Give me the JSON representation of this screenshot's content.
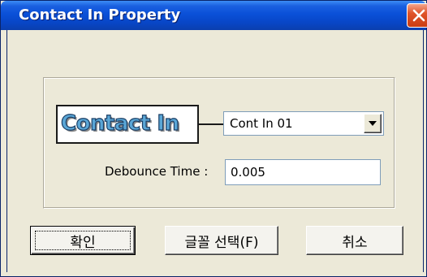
{
  "window": {
    "title": "Contact In Property"
  },
  "logo": {
    "text": "Contact In"
  },
  "contact_select": {
    "selected": "Cont In 01"
  },
  "debounce": {
    "label": "Debounce Time :",
    "value": "0.005"
  },
  "buttons": {
    "ok": "확인",
    "font_select": "글꼴 선택(F)",
    "cancel": "취소"
  },
  "icons": {
    "close": "close-icon",
    "dropdown": "chevron-down-icon"
  },
  "colors": {
    "title_bar": "#0a50d8",
    "close_button": "#e0552b",
    "dialog_background": "#ece9d8",
    "logo_fill": "#5aa6d6"
  }
}
